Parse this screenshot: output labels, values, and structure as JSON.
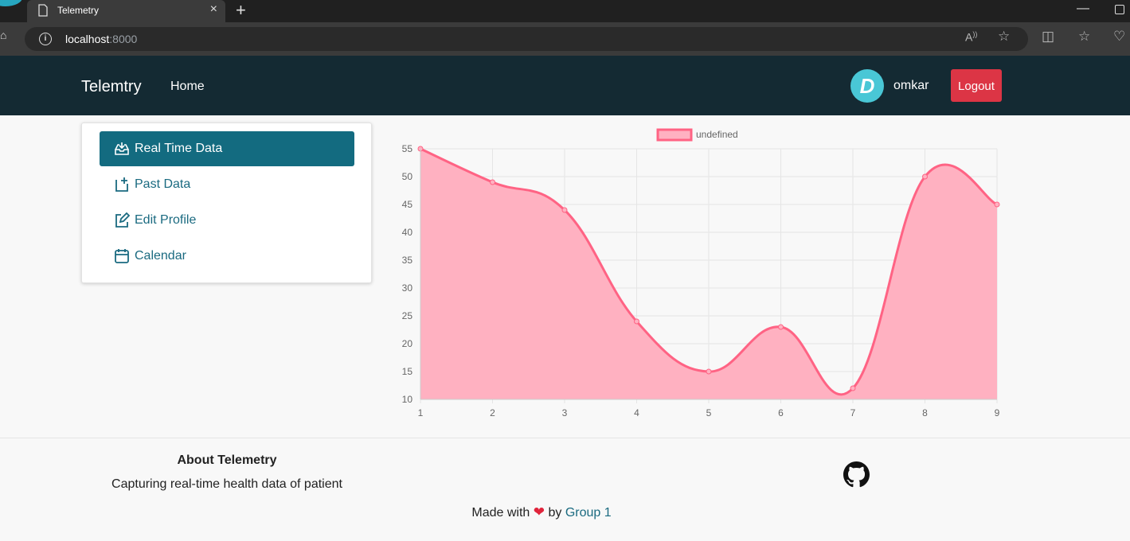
{
  "browser": {
    "tab_title": "Telemetry",
    "url_host": "localhost",
    "url_port": ":8000"
  },
  "navbar": {
    "brand": "Telemtry",
    "home": "Home",
    "avatar_letter": "D",
    "username": "omkar",
    "logout_label": "Logout"
  },
  "sidebar": {
    "items": [
      {
        "label": "Real Time Data",
        "icon": "inbox-icon",
        "active": true
      },
      {
        "label": "Past Data",
        "icon": "add-calendar-icon",
        "active": false
      },
      {
        "label": "Edit Profile",
        "icon": "edit-icon",
        "active": false
      },
      {
        "label": "Calendar",
        "icon": "calendar-icon",
        "active": false
      }
    ]
  },
  "chart_data": {
    "type": "area",
    "x": [
      "1",
      "2",
      "3",
      "4",
      "5",
      "6",
      "7",
      "8",
      "9"
    ],
    "series": [
      {
        "name": "undefined",
        "values": [
          55,
          49,
          44,
          24,
          15,
          23,
          12,
          50,
          45
        ],
        "color": "#ff6384",
        "fill": "#ffb1c1"
      }
    ],
    "ylim": [
      10,
      55
    ],
    "yticks": [
      10,
      15,
      20,
      25,
      30,
      35,
      40,
      45,
      50,
      55
    ],
    "grid": true,
    "legend": "top-center"
  },
  "footer": {
    "about_title": "About Telemetry",
    "about_text": "Capturing real-time health data of patient",
    "made_with": "Made with",
    "by": "by",
    "group": "Group 1"
  }
}
